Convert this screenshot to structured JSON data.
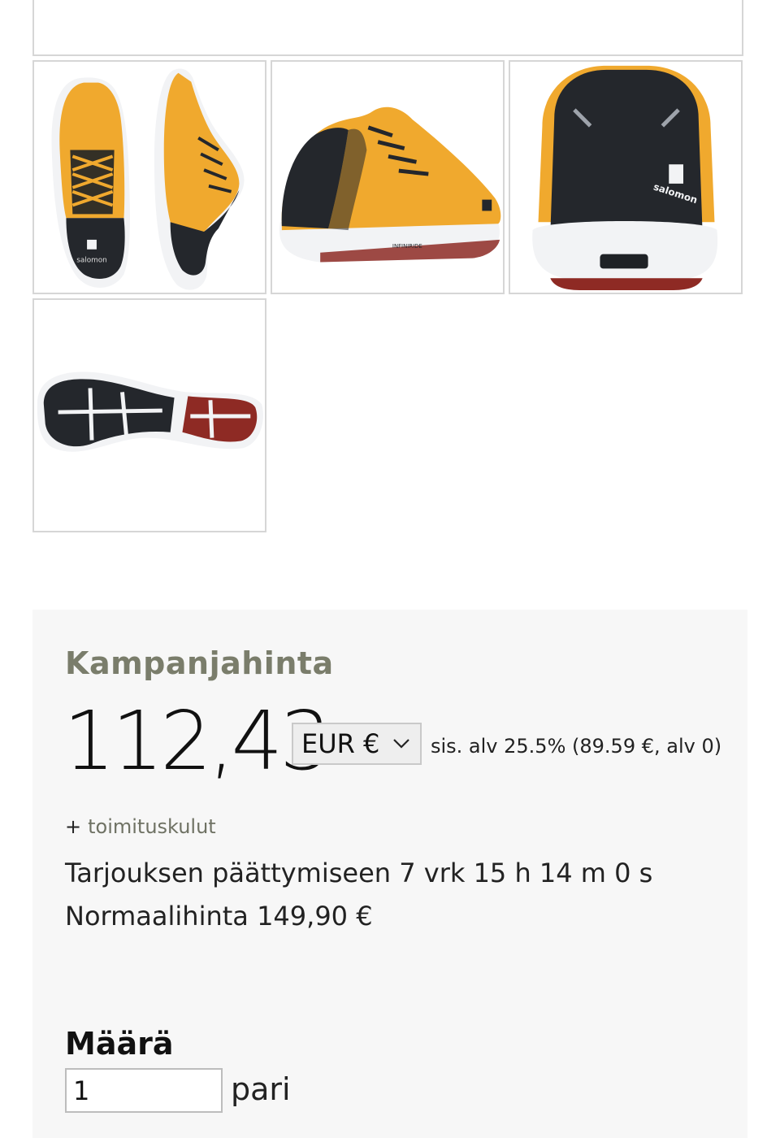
{
  "gallery": {
    "images": [
      {
        "alt": "Product image - top and side view",
        "icon": "shoe-pair-top-side"
      },
      {
        "alt": "Product image - side angle view",
        "icon": "shoe-side"
      },
      {
        "alt": "Product image - rear view",
        "icon": "shoe-rear"
      },
      {
        "alt": "Product image - outsole view",
        "icon": "shoe-outsole"
      }
    ],
    "brand_text": "salomon",
    "midsole_text": "INFINIRIDE"
  },
  "pricing": {
    "campaign_label": "Kampanjahinta",
    "price": "112,43",
    "currency_selected": "EUR €",
    "vat_text": "sis. alv 25.5% (89.59 €, alv 0)",
    "shipping_plus": "+",
    "shipping_text": "toimituskulut",
    "countdown_text": "Tarjouksen päättymiseen 7 vrk 15 h 14 m 0 s",
    "normal_price_text": "Normaalihinta 149,90 €"
  },
  "quantity": {
    "label": "Määrä",
    "value": "1",
    "unit": "pari"
  },
  "colors": {
    "shoe_orange": "#f0a92e",
    "shoe_black": "#24272c",
    "sole_white": "#f2f3f5",
    "sole_red": "#8e2a24",
    "campaign_label": "#7a7d6b",
    "panel_bg": "#f7f7f7"
  }
}
